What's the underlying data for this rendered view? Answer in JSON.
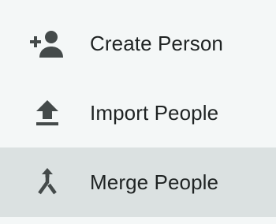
{
  "menu": {
    "items": [
      {
        "label": "Create Person",
        "icon": "add-person-icon"
      },
      {
        "label": "Import People",
        "icon": "upload-icon"
      },
      {
        "label": "Merge People",
        "icon": "merge-icon"
      }
    ],
    "selected_index": 2,
    "colors": {
      "background": "#f4f7f7",
      "selected_background": "#dbe1e1",
      "icon": "#444a4a",
      "text": "#1f2323"
    }
  }
}
